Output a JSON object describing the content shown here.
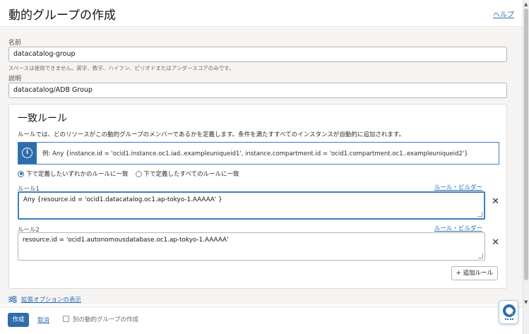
{
  "header": {
    "title": "動的グループの作成",
    "help_link": "ヘルプ"
  },
  "form": {
    "name_label": "名前",
    "name_value": "datacatalog-group",
    "name_hint": "スペースは使用できません。英字、数字、ハイフン、ピリオドまたはアンダースコアのみです。",
    "description_label": "説明",
    "description_value": "datacatalog/ADB Group"
  },
  "matching_rules": {
    "title": "一致ルール",
    "description": "ルールでは、どのリソースがこの動的グループのメンバーであるかを定義します。条件を満たすすべてのインスタンスが自動的に追加されます。",
    "info_example": "例: Any {instance.id = 'ocid1.instance.oc1.iad..exampleuniqueid1', instance.compartment.id = 'ocid1.compartment.oc1..exampleuniqueid2'}",
    "radio_any": "下で定義したいずれかのルールに一致",
    "radio_all": "下で定義したすべてのルールに一致",
    "radio_selected": "any",
    "rules": [
      {
        "label": "ルール1",
        "builder_link": "ルール・ビルダー",
        "value": "Any {resource.id = 'ocid1.datacatalog.oc1.ap-tokyo-1.AAAAA' }"
      },
      {
        "label": "ルール2",
        "builder_link": "ルール・ビルダー",
        "value": "resource.id = 'ocid1.autonomousdatabase.oc1.ap-tokyo-1.AAAAA'"
      }
    ],
    "add_rule_button": "+ 追加ルール"
  },
  "advanced_options_link": "拡張オプションの表示",
  "footer": {
    "create_button": "作成",
    "cancel_link": "取消",
    "another_checkbox_label": "別の動的グループの作成"
  },
  "colors": {
    "primary": "#2d6dab",
    "link": "#2b6cb0"
  },
  "icons": {
    "info": "info-icon",
    "close": "close-icon",
    "advanced": "sliders-icon",
    "help_float": "lifebuoy-icon"
  }
}
